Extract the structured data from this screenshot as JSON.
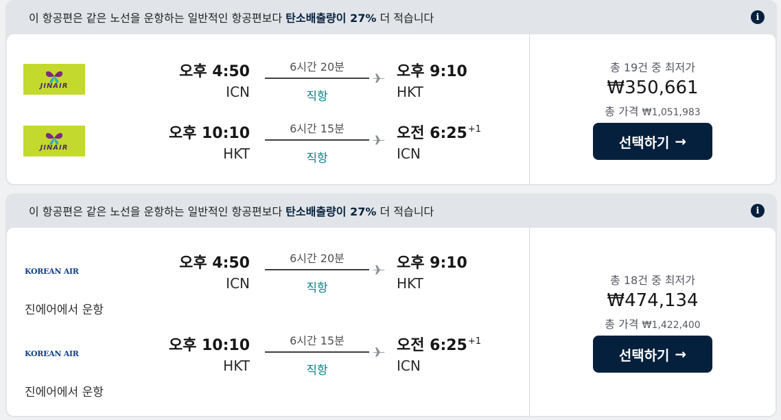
{
  "results": [
    {
      "eco_prefix": "이 항공편은 같은 노선을 운항하는 일반적인 항공편보다 ",
      "eco_highlight": "탄소배출량이 27%",
      "eco_suffix": " 더 적습니다",
      "info_icon": "i",
      "legs": [
        {
          "airline_logo": "jin-air-logo",
          "logo_text": "JINAIR",
          "operated_by": "",
          "dep_time": "오후 4:50",
          "dep_code": "ICN",
          "duration": "6시간 20분",
          "stops": "직항",
          "arr_time": "오후 9:10",
          "arr_offset": "",
          "arr_code": "HKT"
        },
        {
          "airline_logo": "jin-air-logo",
          "logo_text": "JINAIR",
          "operated_by": "",
          "dep_time": "오후 10:10",
          "dep_code": "HKT",
          "duration": "6시간 15분",
          "stops": "직항",
          "arr_time": "오전 6:25",
          "arr_offset": "+1",
          "arr_code": "ICN"
        }
      ],
      "price": {
        "caption": "총 19건 중 최저가",
        "main": "₩350,661",
        "total_label": "총 가격 ",
        "total_value": "₩1,051,983",
        "button": "선택하기",
        "button_icon": "→"
      }
    },
    {
      "eco_prefix": "이 항공편은 같은 노선을 운항하는 일반적인 항공편보다 ",
      "eco_highlight": "탄소배출량이 27%",
      "eco_suffix": " 더 적습니다",
      "info_icon": "i",
      "legs": [
        {
          "airline_logo": "korean-air-logo",
          "logo_text": "KOREAN AIR",
          "operated_by": "진에어에서 운항",
          "dep_time": "오후 4:50",
          "dep_code": "ICN",
          "duration": "6시간 20분",
          "stops": "직항",
          "arr_time": "오후 9:10",
          "arr_offset": "",
          "arr_code": "HKT"
        },
        {
          "airline_logo": "korean-air-logo",
          "logo_text": "KOREAN AIR",
          "operated_by": "진에어에서 운항",
          "dep_time": "오후 10:10",
          "dep_code": "HKT",
          "duration": "6시간 15분",
          "stops": "직항",
          "arr_time": "오전 6:25",
          "arr_offset": "+1",
          "arr_code": "ICN"
        }
      ],
      "price": {
        "caption": "총 18건 중 최저가",
        "main": "₩474,134",
        "total_label": "총 가격 ",
        "total_value": "₩1,422,400",
        "button": "선택하기",
        "button_icon": "→"
      }
    }
  ]
}
